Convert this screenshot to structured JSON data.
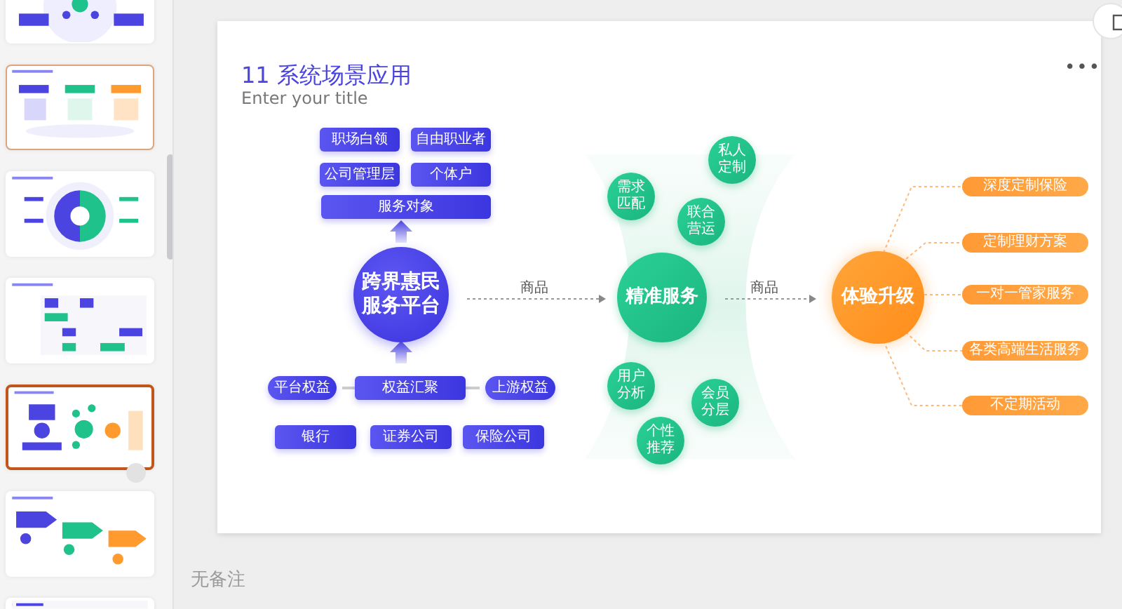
{
  "slides": [
    {
      "kind": "ring",
      "selected": false,
      "highlighted": false
    },
    {
      "kind": "flow",
      "selected": false,
      "highlighted": true
    },
    {
      "kind": "donut",
      "selected": false,
      "highlighted": false
    },
    {
      "kind": "table",
      "selected": false,
      "highlighted": false
    },
    {
      "kind": "diagram",
      "selected": true,
      "highlighted": false
    },
    {
      "kind": "arrows",
      "selected": false,
      "highlighted": false
    },
    {
      "kind": "title",
      "selected": false,
      "highlighted": false
    }
  ],
  "slide": {
    "title": "11 系统场景应用",
    "subtitle": "Enter your title",
    "more": "•••",
    "audience": {
      "items": [
        "职场白领",
        "自由职业者",
        "公司管理层",
        "个体户"
      ],
      "label": "服务对象"
    },
    "platform": {
      "lines": [
        "跨界惠民",
        "服务平台"
      ]
    },
    "rights": {
      "left": "平台权益",
      "center": "权益汇聚",
      "right": "上游权益"
    },
    "partners": [
      "银行",
      "证券公司",
      "保险公司"
    ],
    "flow_labels": [
      "商品",
      "商品"
    ],
    "service": {
      "lines": [
        "精准服务"
      ]
    },
    "service_nodes": [
      {
        "lines": [
          "需求",
          "匹配"
        ]
      },
      {
        "lines": [
          "私人",
          "定制"
        ]
      },
      {
        "lines": [
          "联合",
          "营运"
        ]
      },
      {
        "lines": [
          "用户",
          "分析"
        ]
      },
      {
        "lines": [
          "会员",
          "分层"
        ]
      },
      {
        "lines": [
          "个性",
          "推荐"
        ]
      }
    ],
    "upgrade": {
      "lines": [
        "体验升级"
      ]
    },
    "benefits": [
      "深度定制保险",
      "定制理财方案",
      "一对一管家服务",
      "各类高端生活服务",
      "不定期活动"
    ]
  },
  "notes": {
    "placeholder": "无备注"
  }
}
